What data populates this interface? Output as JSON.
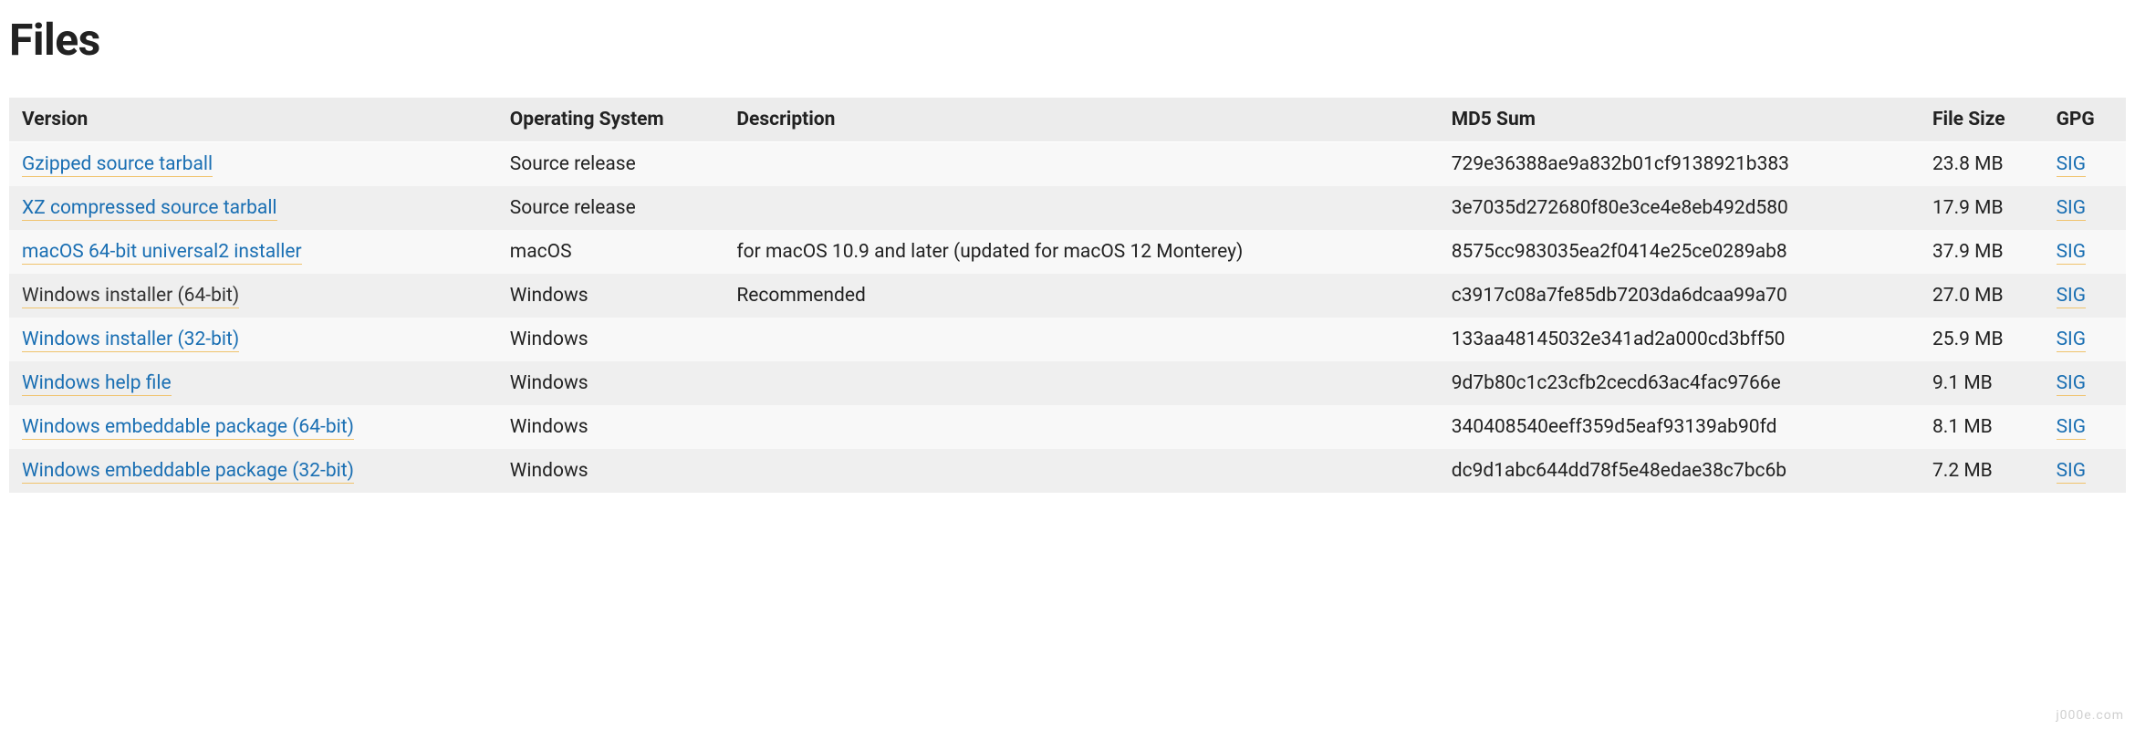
{
  "heading": "Files",
  "columns": {
    "version": "Version",
    "os": "Operating System",
    "description": "Description",
    "md5": "MD5 Sum",
    "size": "File Size",
    "gpg": "GPG"
  },
  "sig_label": "SIG",
  "rows": [
    {
      "version": "Gzipped source tarball",
      "visited": false,
      "os": "Source release",
      "description": "",
      "md5": "729e36388ae9a832b01cf9138921b383",
      "size": "23.8 MB"
    },
    {
      "version": "XZ compressed source tarball",
      "visited": false,
      "os": "Source release",
      "description": "",
      "md5": "3e7035d272680f80e3ce4e8eb492d580",
      "size": "17.9 MB"
    },
    {
      "version": "macOS 64-bit universal2 installer",
      "visited": false,
      "os": "macOS",
      "description": "for macOS 10.9 and later (updated for macOS 12 Monterey)",
      "md5": "8575cc983035ea2f0414e25ce0289ab8",
      "size": "37.9 MB"
    },
    {
      "version": "Windows installer (64-bit)",
      "visited": true,
      "os": "Windows",
      "description": "Recommended",
      "md5": "c3917c08a7fe85db7203da6dcaa99a70",
      "size": "27.0 MB"
    },
    {
      "version": "Windows installer (32-bit)",
      "visited": false,
      "os": "Windows",
      "description": "",
      "md5": "133aa48145032e341ad2a000cd3bff50",
      "size": "25.9 MB"
    },
    {
      "version": "Windows help file",
      "visited": false,
      "os": "Windows",
      "description": "",
      "md5": "9d7b80c1c23cfb2cecd63ac4fac9766e",
      "size": "9.1 MB"
    },
    {
      "version": "Windows embeddable package (64-bit)",
      "visited": false,
      "os": "Windows",
      "description": "",
      "md5": "340408540eeff359d5eaf93139ab90fd",
      "size": "8.1 MB"
    },
    {
      "version": "Windows embeddable package (32-bit)",
      "visited": false,
      "os": "Windows",
      "description": "",
      "md5": "dc9d1abc644dd78f5e48edae38c7bc6b",
      "size": "7.2 MB"
    }
  ],
  "watermark": "j000e.com"
}
